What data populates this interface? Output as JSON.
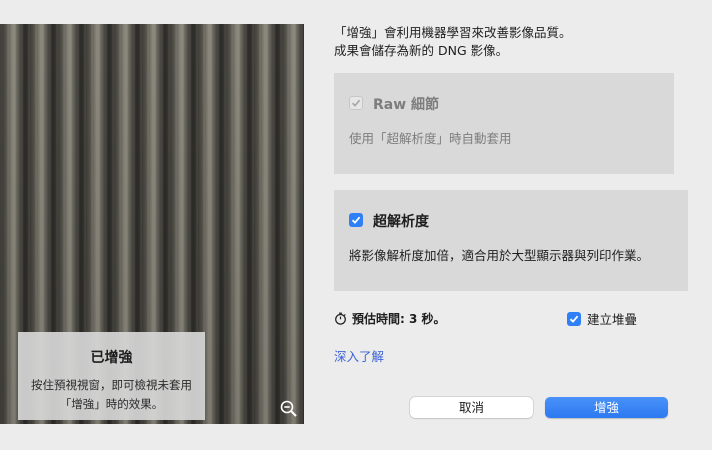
{
  "preview": {
    "overlay_title": "已增強",
    "overlay_desc_line1": "按住預視視窗，即可檢視未套用",
    "overlay_desc_line2": "「增強」時的效果。",
    "zoom_icon": "zoom-out-icon"
  },
  "intro": {
    "line1": "「增強」會利用機器學習來改善影像品質。",
    "line2": "成果會儲存為新的 DNG 影像。"
  },
  "options": {
    "raw_details": {
      "label": "Raw 細節",
      "desc": "使用「超解析度」時自動套用",
      "checked": true,
      "enabled": false
    },
    "super_resolution": {
      "label": "超解析度",
      "desc": "將影像解析度加倍，適合用於大型顯示器與列印作業。",
      "checked": true,
      "enabled": true
    }
  },
  "estimate": {
    "icon": "stopwatch-icon",
    "text": "預估時間: 3 秒。"
  },
  "create_stack": {
    "label": "建立堆疊",
    "checked": true
  },
  "learn_more": "深入了解",
  "buttons": {
    "cancel": "取消",
    "enhance": "增強"
  },
  "colors": {
    "accent": "#2f7ff7",
    "link": "#3c63d9",
    "background": "#ececec"
  }
}
